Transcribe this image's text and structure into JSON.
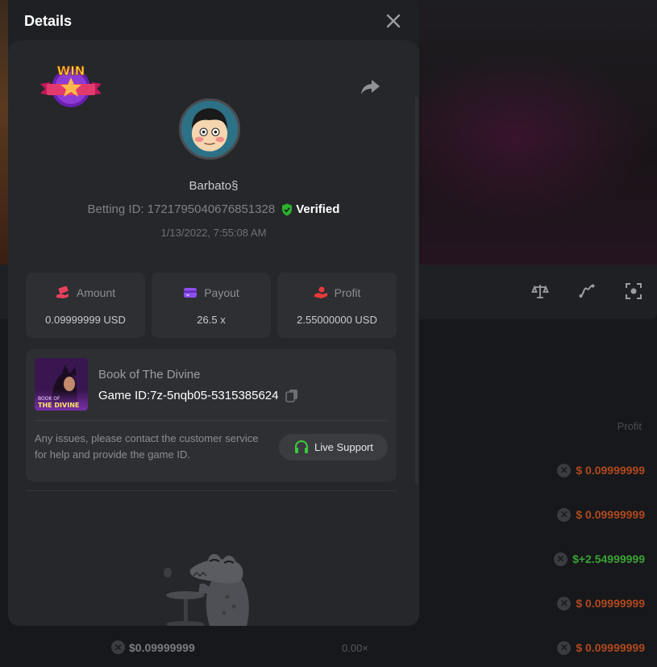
{
  "background": {
    "table": {
      "column_header": "Profit",
      "rows": [
        {
          "sign": "$",
          "value": "0.09999999",
          "status": "loss"
        },
        {
          "sign": "$",
          "value": "0.09999999",
          "status": "loss"
        },
        {
          "sign": "$",
          "value": "+2.54999999",
          "status": "win"
        },
        {
          "sign": "$",
          "value": "0.09999999",
          "status": "loss"
        },
        {
          "sign": "$",
          "value": "0.09999999",
          "status": "loss"
        }
      ]
    },
    "bottom_row": {
      "amount": "$0.09999999",
      "multiplier": "0.00×"
    },
    "toolbar_icons": [
      "scale-icon",
      "chart-curve-icon",
      "fullscreen-icon"
    ]
  },
  "modal": {
    "title": "Details",
    "badge_text": "WIN",
    "user": {
      "name": "Barbato§",
      "betting_id": "Betting ID: 1721795040676851328",
      "verified_label": "Verified",
      "datetime": "1/13/2022, 7:55:08 AM"
    },
    "stats": [
      {
        "label": "Amount",
        "value": "0.09999999 USD",
        "icon": "money-hand-icon"
      },
      {
        "label": "Payout",
        "value": "26.5 x",
        "icon": "wallet-icon"
      },
      {
        "label": "Profit",
        "value": "2.55000000 USD",
        "icon": "profit-hand-icon"
      }
    ],
    "game": {
      "name": "Book of The Divine",
      "game_id": "Game ID:7z-5nqb05-5315385624",
      "thumb_text_top": "BOOK OF",
      "thumb_text_bottom": "THE DIVINE",
      "support_text": "Any issues, please contact the customer service for help and provide the game ID.",
      "live_support_label": "Live Support"
    }
  },
  "colors": {
    "loss": "#b0491e",
    "win": "#3aa336",
    "verified": "#2bb32b",
    "modal_bg": "#1f2023",
    "card_bg": "#2d2f33"
  }
}
